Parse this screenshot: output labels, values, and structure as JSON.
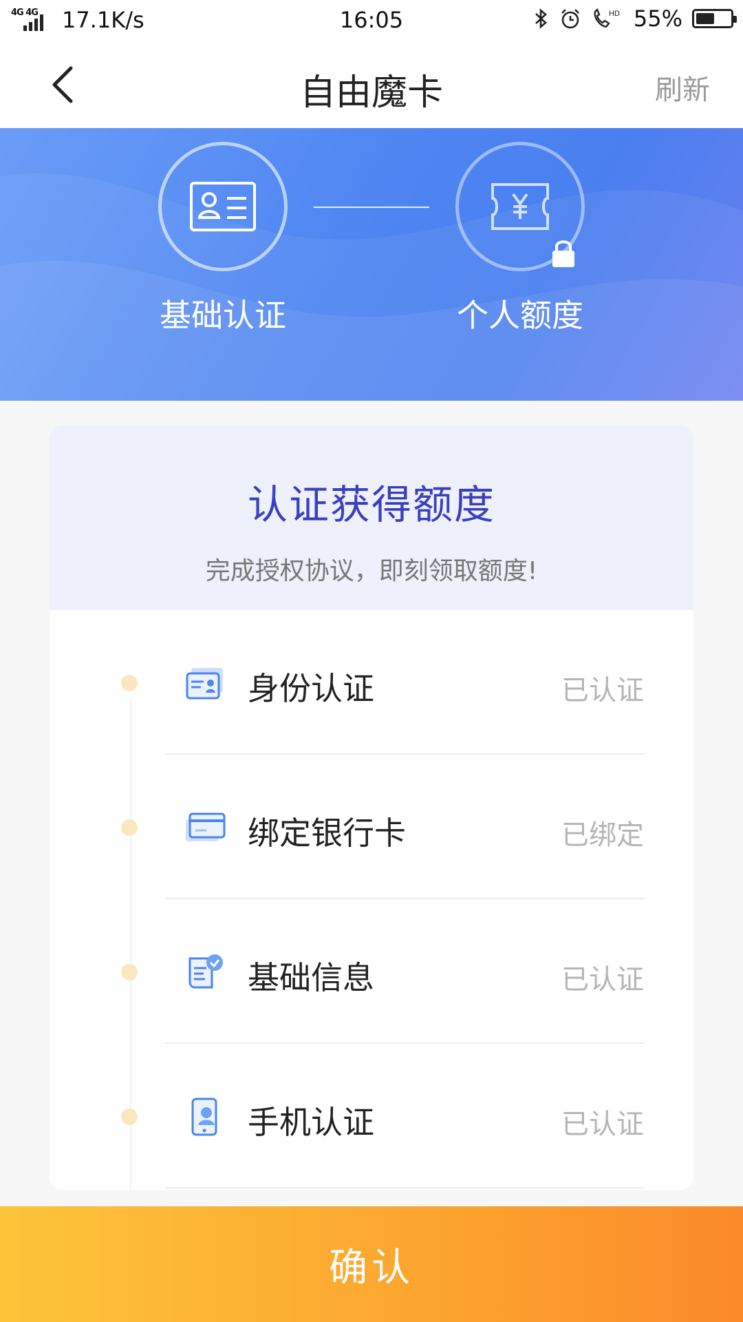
{
  "status_bar": {
    "network": "4G 4G",
    "speed": "17.1K/s",
    "time": "16:05",
    "battery": "55%",
    "battery_level": 0.55,
    "icons": [
      "bluetooth-icon",
      "alarm-icon",
      "hd-call-icon",
      "battery-icon"
    ]
  },
  "nav": {
    "title": "自由魔卡",
    "refresh_label": "刷新",
    "back_icon": "chevron-left-icon"
  },
  "banner": {
    "steps": [
      {
        "label": "基础认证",
        "icon": "id-card-icon",
        "locked": false
      },
      {
        "label": "个人额度",
        "icon": "yuan-ticket-icon",
        "locked": true
      }
    ],
    "colors": {
      "start": "#6a9cf7",
      "end": "#6b7ff0"
    }
  },
  "card": {
    "title": "认证获得额度",
    "subtitle": "完成授权协议，即刻领取额度!",
    "items": [
      {
        "label": "身份认证",
        "status": "已认证",
        "icon": "id-card-icon"
      },
      {
        "label": "绑定银行卡",
        "status": "已绑定",
        "icon": "bank-card-icon"
      },
      {
        "label": "基础信息",
        "status": "已认证",
        "icon": "info-scroll-icon"
      },
      {
        "label": "手机认证",
        "status": "已认证",
        "icon": "phone-icon"
      }
    ]
  },
  "footer": {
    "confirm_label": "确认",
    "colors": {
      "start": "#fdc43a",
      "end": "#fb8a2a"
    }
  }
}
